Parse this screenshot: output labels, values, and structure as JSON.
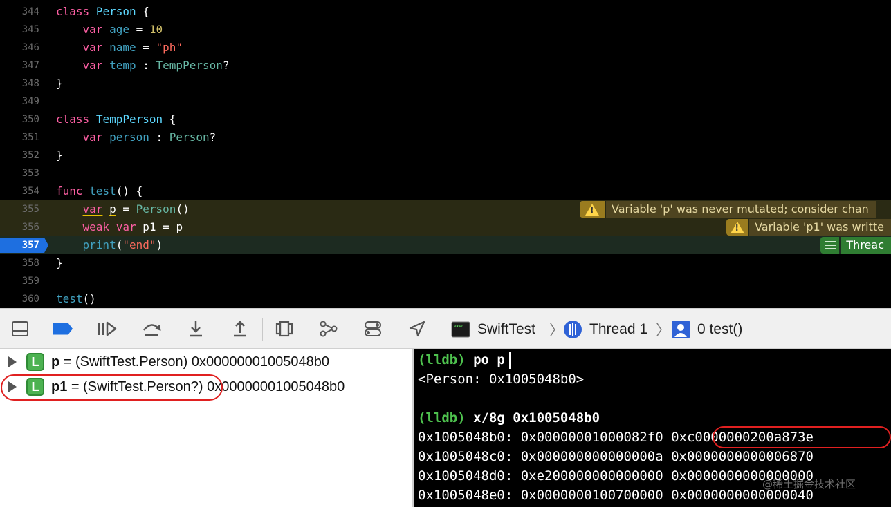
{
  "editor": {
    "line_numbers": [
      "344",
      "345",
      "346",
      "347",
      "348",
      "349",
      "350",
      "351",
      "352",
      "353",
      "354",
      "355",
      "356",
      "357",
      "358",
      "359",
      "360"
    ],
    "code": {
      "l344": {
        "kw": "class",
        "name": "Person",
        "brace": "{"
      },
      "l345": {
        "kw": "var",
        "id": "age",
        "eq": "=",
        "val": "10"
      },
      "l346": {
        "kw": "var",
        "id": "name",
        "eq": "=",
        "val": "\"ph\""
      },
      "l347": {
        "kw": "var",
        "id": "temp",
        "colon": ":",
        "type": "TempPerson",
        "q": "?"
      },
      "l348": {
        "brace": "}"
      },
      "l350": {
        "kw": "class",
        "name": "TempPerson",
        "brace": "{"
      },
      "l351": {
        "kw": "var",
        "id": "person",
        "colon": ":",
        "type": "Person",
        "q": "?"
      },
      "l352": {
        "brace": "}"
      },
      "l354": {
        "kw": "func",
        "name": "test",
        "rest": "() {"
      },
      "l355": {
        "kw": "var",
        "id": "p",
        "eq": "=",
        "call": "Person",
        "rest": "()"
      },
      "l356": {
        "kw1": "weak",
        "kw2": "var",
        "id": "p1",
        "eq": "=",
        "rhs": "p"
      },
      "l357": {
        "fn": "print",
        "open": "(",
        "str": "\"end\"",
        "close": ")"
      },
      "l358": {
        "brace": "}"
      },
      "l360": {
        "fn": "test",
        "rest": "()"
      }
    },
    "annotations": {
      "warn1": "Variable 'p' was never mutated; consider chan",
      "warn2": "Variable 'p1' was writte",
      "thread": "Threac"
    }
  },
  "debug_bar": {
    "breadcrumb": {
      "target": "SwiftTest",
      "thread": "Thread 1",
      "frame": "0 test()"
    }
  },
  "variables": [
    {
      "name": "p",
      "eq": " = ",
      "type": "(SwiftTest.Person)",
      "value": "0x00000001005048b0"
    },
    {
      "name": "p1",
      "eq": " = ",
      "type": "(SwiftTest.Person?)",
      "value": "0x00000001005048b0"
    }
  ],
  "console": {
    "cmd1_prompt": "(lldb)",
    "cmd1": "po p",
    "out1": "<Person: 0x1005048b0>",
    "cmd2_prompt": "(lldb)",
    "cmd2": "x/8g 0x1005048b0",
    "rows": [
      {
        "addr": "0x1005048b0:",
        "a": "0x00000001000082f0",
        "b": "0xc0000000200a873e"
      },
      {
        "addr": "0x1005048c0:",
        "a": "0x000000000000000a",
        "b": "0x0000000000006870"
      },
      {
        "addr": "0x1005048d0:",
        "a": "0xe200000000000000",
        "b": "0x0000000000000000"
      },
      {
        "addr": "0x1005048e0:",
        "a": "0x0000000100700000",
        "b": "0x0000000000000040"
      }
    ]
  },
  "watermark": "@稀土掘金技术社区",
  "colors": {
    "keyword": "#fc5fa3",
    "type": "#5dd8ff",
    "string": "#fc6a5d",
    "number": "#d0bf69",
    "lldb_prompt": "#4ec24e",
    "current_line_marker": "#1e6fe0",
    "highlight_ring": "#e02020"
  }
}
